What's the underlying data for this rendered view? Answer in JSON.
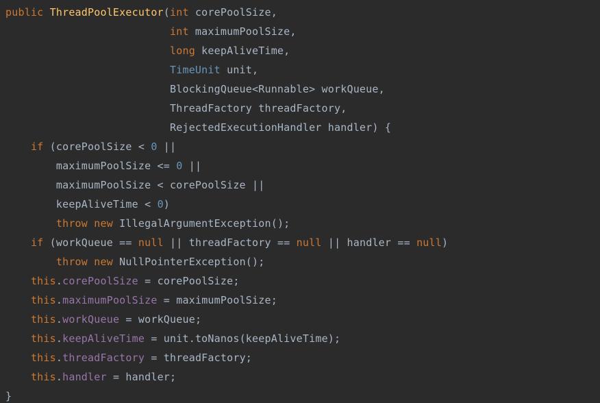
{
  "code": {
    "l01": {
      "kw_public": "public",
      "ctor": "ThreadPoolExecutor",
      "punc_open": "(",
      "kw_int1": "int",
      "p1": " corePoolSize,",
      "pad": " "
    },
    "l02": {
      "pad": "                          ",
      "kw_int": "int",
      "p": " maximumPoolSize,"
    },
    "l03": {
      "pad": "                          ",
      "kw_long": "long",
      "p": " keepAliveTime,"
    },
    "l04": {
      "pad": "                          ",
      "type": "TimeUnit",
      "p": " unit,"
    },
    "l05": {
      "pad": "                          ",
      "p": "BlockingQueue<Runnable> workQueue,"
    },
    "l06": {
      "pad": "                          ",
      "p": "ThreadFactory threadFactory,"
    },
    "l07": {
      "pad": "                          ",
      "p": "RejectedExecutionHandler handler) {"
    },
    "l08": {
      "pad": "    ",
      "kw_if": "if",
      "a": " (corePoolSize < ",
      "zero": "0",
      "b": " ||"
    },
    "l09": {
      "pad": "        ",
      "a": "maximumPoolSize <= ",
      "zero": "0",
      "b": " ||"
    },
    "l10": {
      "pad": "        ",
      "a": "maximumPoolSize < corePoolSize ||"
    },
    "l11": {
      "pad": "        ",
      "a": "keepAliveTime < ",
      "zero": "0",
      "b": ")"
    },
    "l12": {
      "pad": "        ",
      "kw_throw": "throw",
      "sp": " ",
      "kw_new": "new",
      "rest": " IllegalArgumentException();"
    },
    "l13": {
      "pad": "    ",
      "kw_if": "if",
      "a": " (workQueue == ",
      "kw_null1": "null",
      "b": " || threadFactory == ",
      "kw_null2": "null",
      "c": " || handler == ",
      "kw_null3": "null",
      "d": ")"
    },
    "l14": {
      "pad": "        ",
      "kw_throw": "throw",
      "sp": " ",
      "kw_new": "new",
      "rest": " NullPointerException();"
    },
    "l15": {
      "pad": "    ",
      "kw_this": "this",
      "dot": ".",
      "field": "corePoolSize",
      "rest": " = corePoolSize;"
    },
    "l16": {
      "pad": "    ",
      "kw_this": "this",
      "dot": ".",
      "field": "maximumPoolSize",
      "rest": " = maximumPoolSize;"
    },
    "l17": {
      "pad": "    ",
      "kw_this": "this",
      "dot": ".",
      "field": "workQueue",
      "rest": " = workQueue;"
    },
    "l18": {
      "pad": "    ",
      "kw_this": "this",
      "dot": ".",
      "field": "keepAliveTime",
      "rest": " = unit.toNanos(keepAliveTime);"
    },
    "l19": {
      "pad": "    ",
      "kw_this": "this",
      "dot": ".",
      "field": "threadFactory",
      "rest": " = threadFactory;"
    },
    "l20": {
      "pad": "    ",
      "kw_this": "this",
      "dot": ".",
      "field": "handler",
      "rest": " = handler;"
    },
    "l21": {
      "p": "}"
    }
  }
}
